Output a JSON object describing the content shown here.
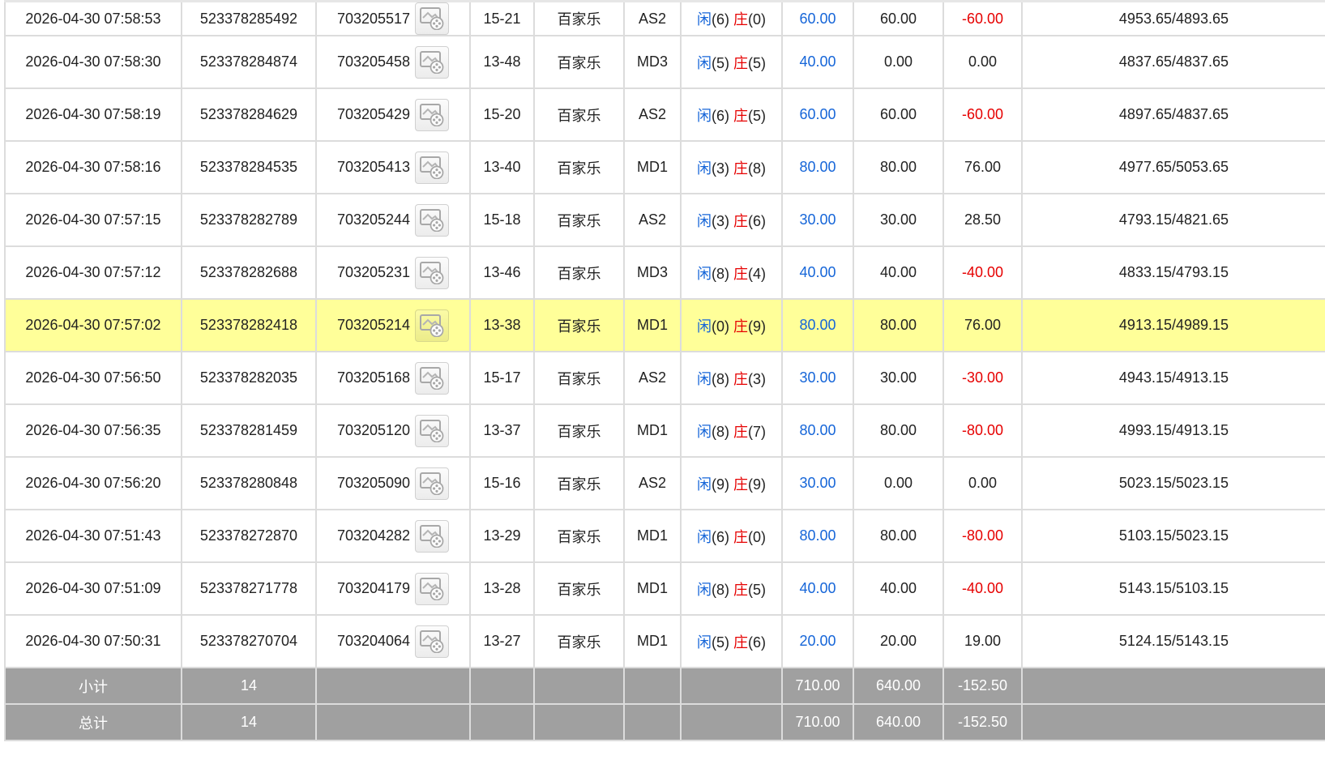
{
  "columns": [
    "time",
    "bet_id",
    "game_id",
    "table",
    "game",
    "hall",
    "result",
    "bet",
    "valid",
    "win",
    "balance"
  ],
  "rows": [
    {
      "time": "2026-04-30 07:58:53",
      "bet_id": "523378285492",
      "game_id": "703205517",
      "table": "15-21",
      "game": "百家乐",
      "hall": "AS2",
      "xian_label": "闲",
      "xian_num": "(6)",
      "zhuang_label": "庄",
      "zhuang_num": "(0)",
      "bet": "60.00",
      "valid": "60.00",
      "win": "-60.00",
      "balance": "4953.65/4893.65",
      "highlight": false
    },
    {
      "time": "2026-04-30 07:58:30",
      "bet_id": "523378284874",
      "game_id": "703205458",
      "table": "13-48",
      "game": "百家乐",
      "hall": "MD3",
      "xian_label": "闲",
      "xian_num": "(5)",
      "zhuang_label": "庄",
      "zhuang_num": "(5)",
      "bet": "40.00",
      "valid": "0.00",
      "win": "0.00",
      "balance": "4837.65/4837.65",
      "highlight": false
    },
    {
      "time": "2026-04-30 07:58:19",
      "bet_id": "523378284629",
      "game_id": "703205429",
      "table": "15-20",
      "game": "百家乐",
      "hall": "AS2",
      "xian_label": "闲",
      "xian_num": "(6)",
      "zhuang_label": "庄",
      "zhuang_num": "(5)",
      "bet": "60.00",
      "valid": "60.00",
      "win": "-60.00",
      "balance": "4897.65/4837.65",
      "highlight": false
    },
    {
      "time": "2026-04-30 07:58:16",
      "bet_id": "523378284535",
      "game_id": "703205413",
      "table": "13-40",
      "game": "百家乐",
      "hall": "MD1",
      "xian_label": "闲",
      "xian_num": "(3)",
      "zhuang_label": "庄",
      "zhuang_num": "(8)",
      "bet": "80.00",
      "valid": "80.00",
      "win": "76.00",
      "balance": "4977.65/5053.65",
      "highlight": false
    },
    {
      "time": "2026-04-30 07:57:15",
      "bet_id": "523378282789",
      "game_id": "703205244",
      "table": "15-18",
      "game": "百家乐",
      "hall": "AS2",
      "xian_label": "闲",
      "xian_num": "(3)",
      "zhuang_label": "庄",
      "zhuang_num": "(6)",
      "bet": "30.00",
      "valid": "30.00",
      "win": "28.50",
      "balance": "4793.15/4821.65",
      "highlight": false
    },
    {
      "time": "2026-04-30 07:57:12",
      "bet_id": "523378282688",
      "game_id": "703205231",
      "table": "13-46",
      "game": "百家乐",
      "hall": "MD3",
      "xian_label": "闲",
      "xian_num": "(8)",
      "zhuang_label": "庄",
      "zhuang_num": "(4)",
      "bet": "40.00",
      "valid": "40.00",
      "win": "-40.00",
      "balance": "4833.15/4793.15",
      "highlight": false
    },
    {
      "time": "2026-04-30 07:57:02",
      "bet_id": "523378282418",
      "game_id": "703205214",
      "table": "13-38",
      "game": "百家乐",
      "hall": "MD1",
      "xian_label": "闲",
      "xian_num": "(0)",
      "zhuang_label": "庄",
      "zhuang_num": "(9)",
      "bet": "80.00",
      "valid": "80.00",
      "win": "76.00",
      "balance": "4913.15/4989.15",
      "highlight": true
    },
    {
      "time": "2026-04-30 07:56:50",
      "bet_id": "523378282035",
      "game_id": "703205168",
      "table": "15-17",
      "game": "百家乐",
      "hall": "AS2",
      "xian_label": "闲",
      "xian_num": "(8)",
      "zhuang_label": "庄",
      "zhuang_num": "(3)",
      "bet": "30.00",
      "valid": "30.00",
      "win": "-30.00",
      "balance": "4943.15/4913.15",
      "highlight": false
    },
    {
      "time": "2026-04-30 07:56:35",
      "bet_id": "523378281459",
      "game_id": "703205120",
      "table": "13-37",
      "game": "百家乐",
      "hall": "MD1",
      "xian_label": "闲",
      "xian_num": "(8)",
      "zhuang_label": "庄",
      "zhuang_num": "(7)",
      "bet": "80.00",
      "valid": "80.00",
      "win": "-80.00",
      "balance": "4993.15/4913.15",
      "highlight": false
    },
    {
      "time": "2026-04-30 07:56:20",
      "bet_id": "523378280848",
      "game_id": "703205090",
      "table": "15-16",
      "game": "百家乐",
      "hall": "AS2",
      "xian_label": "闲",
      "xian_num": "(9)",
      "zhuang_label": "庄",
      "zhuang_num": "(9)",
      "bet": "30.00",
      "valid": "0.00",
      "win": "0.00",
      "balance": "5023.15/5023.15",
      "highlight": false
    },
    {
      "time": "2026-04-30 07:51:43",
      "bet_id": "523378272870",
      "game_id": "703204282",
      "table": "13-29",
      "game": "百家乐",
      "hall": "MD1",
      "xian_label": "闲",
      "xian_num": "(6)",
      "zhuang_label": "庄",
      "zhuang_num": "(0)",
      "bet": "80.00",
      "valid": "80.00",
      "win": "-80.00",
      "balance": "5103.15/5023.15",
      "highlight": false
    },
    {
      "time": "2026-04-30 07:51:09",
      "bet_id": "523378271778",
      "game_id": "703204179",
      "table": "13-28",
      "game": "百家乐",
      "hall": "MD1",
      "xian_label": "闲",
      "xian_num": "(8)",
      "zhuang_label": "庄",
      "zhuang_num": "(5)",
      "bet": "40.00",
      "valid": "40.00",
      "win": "-40.00",
      "balance": "5143.15/5103.15",
      "highlight": false
    },
    {
      "time": "2026-04-30 07:50:31",
      "bet_id": "523378270704",
      "game_id": "703204064",
      "table": "13-27",
      "game": "百家乐",
      "hall": "MD1",
      "xian_label": "闲",
      "xian_num": "(5)",
      "zhuang_label": "庄",
      "zhuang_num": "(6)",
      "bet": "20.00",
      "valid": "20.00",
      "win": "19.00",
      "balance": "5124.15/5143.15",
      "highlight": false
    }
  ],
  "subtotal": {
    "label": "小计",
    "count": "14",
    "bet": "710.00",
    "valid": "640.00",
    "win": "-152.50"
  },
  "total": {
    "label": "总计",
    "count": "14",
    "bet": "710.00",
    "valid": "640.00",
    "win": "-152.50"
  },
  "icons": {
    "video_replay": "video-replay-icon"
  },
  "colors": {
    "blue": "#1565d8",
    "red": "#e60000",
    "highlight": "#ffff99",
    "summary_bg": "#a0a0a0"
  }
}
